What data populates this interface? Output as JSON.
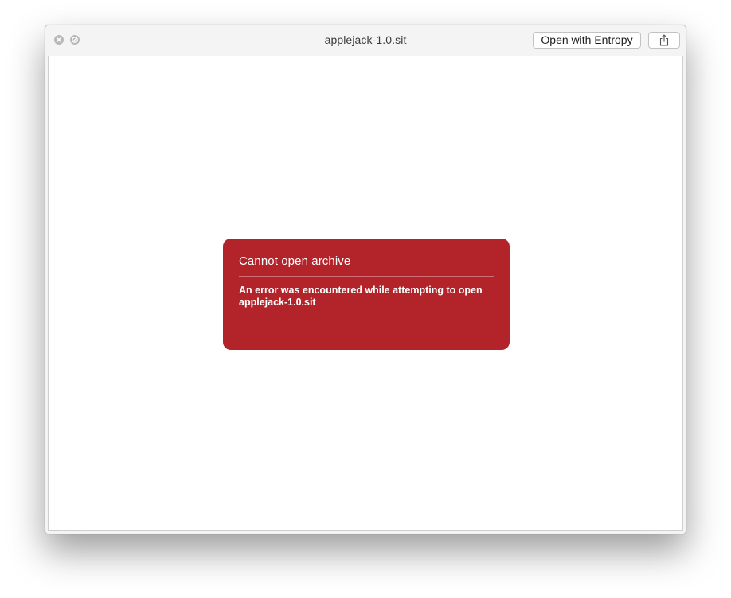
{
  "window": {
    "title": "applejack-1.0.sit"
  },
  "toolbar": {
    "open_with_label": "Open with Entropy",
    "share_icon": "share-icon"
  },
  "error": {
    "title": "Cannot open archive",
    "message_line1": "An error was encountered while attempting to open",
    "message_line2": "applejack-1.0.sit"
  },
  "colors": {
    "error_background": "#b3232a",
    "window_chrome": "#f4f4f4",
    "traffic_light": "#b9b9b9"
  }
}
